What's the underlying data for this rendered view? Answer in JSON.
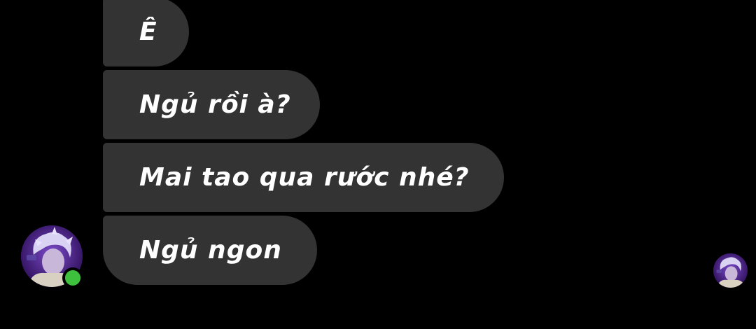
{
  "conversation": {
    "messages": [
      {
        "text": "Ê"
      },
      {
        "text": "Ngủ rồi à?"
      },
      {
        "text": "Mai tao qua rước nhé?"
      },
      {
        "text": "Ngủ ngon"
      }
    ]
  },
  "sender": {
    "avatar_icon": "user-avatar-photo",
    "online": true,
    "status_color": "#3ec23e"
  },
  "read_receipt": {
    "avatar_icon": "seen-avatar-photo"
  },
  "colors": {
    "background": "#000000",
    "bubble": "#333333",
    "text": "#ffffff",
    "avatar_purple": "#5a22a0"
  }
}
